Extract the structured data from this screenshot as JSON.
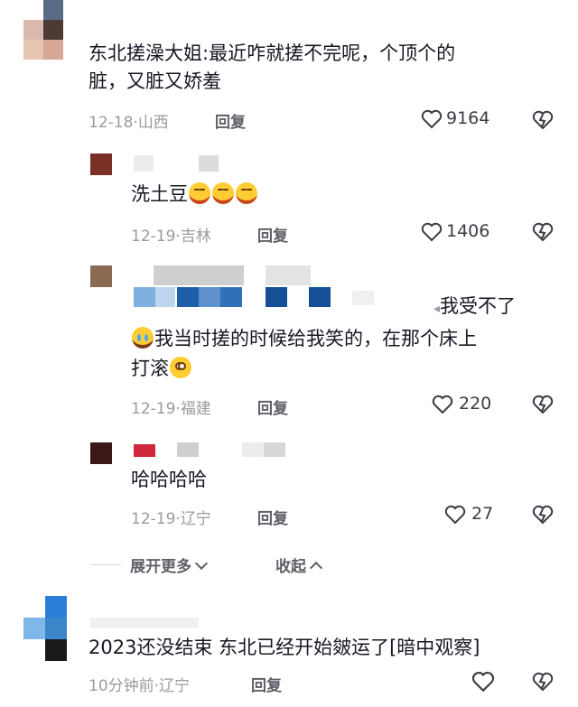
{
  "colors": {
    "avatar1": [
      "#5a6b86",
      "#d9b9ae",
      "#a8776c",
      "#e5c4b1",
      "#4b3b33",
      "#d6a696"
    ],
    "avatar2": "#7a3026",
    "avatar3": "#8a6a52",
    "avatar4": "#3a1818",
    "avatar5": [
      "#2b7fd8",
      "#7fb7e8",
      "#1a1a1a",
      "#3a86c8"
    ],
    "blur_grey": "#cfcfd2",
    "blur_blue": "#1d5fa8",
    "blur_red": "#d0273a"
  },
  "comments": [
    {
      "text": "东北搓澡大姐:最近咋就搓不完呢，个顶个的脏，又脏又娇羞",
      "line1": "东北搓澡大姐:最近咋就搓不完呢，个顶个的",
      "line2": "脏，又脏又娇羞",
      "date": "12-18",
      "sep": "·",
      "location": "山西",
      "reply_label": "回复",
      "likes": "9164"
    },
    {
      "text": "洗土豆",
      "emojis": [
        "laugh",
        "laugh",
        "laugh"
      ],
      "date": "12-19",
      "sep": "·",
      "location": "吉林",
      "reply_label": "回复",
      "likes": "1406"
    },
    {
      "arrow_text": "我受不了",
      "line1": "我当时搓的时候给我笑的，在那个床上",
      "line2": "打滚",
      "date": "12-19",
      "sep": "·",
      "location": "福建",
      "reply_label": "回复",
      "likes": "220"
    },
    {
      "text": "哈哈哈哈",
      "date": "12-19",
      "sep": "·",
      "location": "辽宁",
      "reply_label": "回复",
      "likes": "27"
    },
    {
      "text": "2023还没结束 东北已经开始皴运了[暗中观察]",
      "date": "10分钟前",
      "sep": "·",
      "location": "辽宁",
      "reply_label": "回复",
      "likes": ""
    }
  ],
  "thread_controls": {
    "expand_label": "展开更多",
    "collapse_label": "收起"
  }
}
